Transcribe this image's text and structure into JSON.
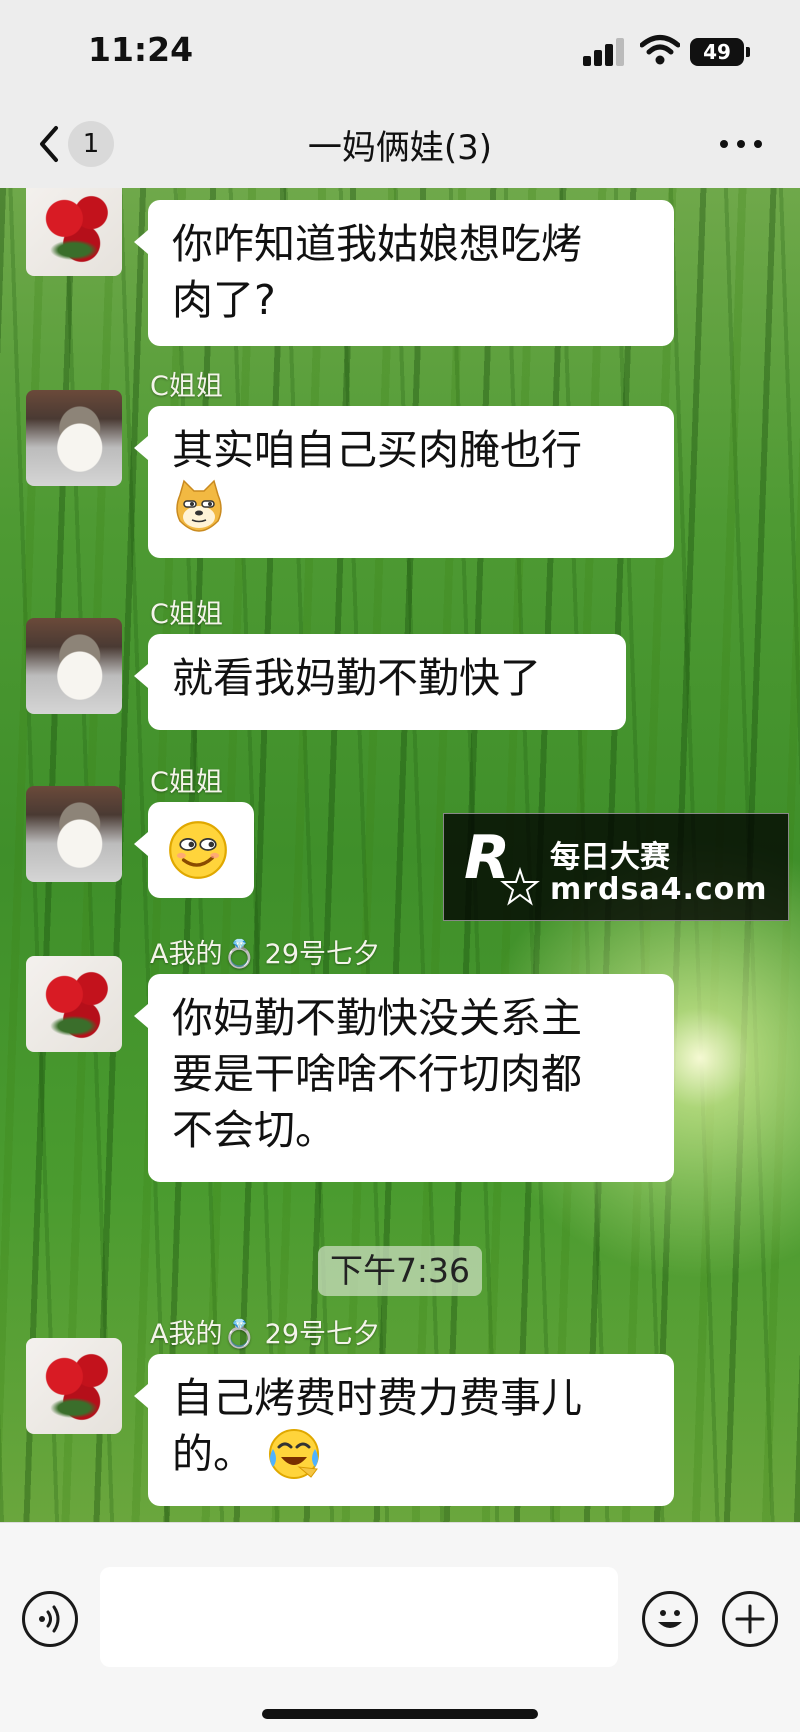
{
  "status_bar": {
    "time": "11:24",
    "battery": "49"
  },
  "nav": {
    "unread_count": "1",
    "title": "一妈俩娃(3)"
  },
  "messages": [
    {
      "text_lines": [
        "你咋知道我姑娘想吃烤",
        "肉了?"
      ],
      "avatar": "rose"
    },
    {
      "sender": "C姐姐",
      "text_lines": [
        "其实咱自己买肉腌也行"
      ],
      "emoji": "doge-emoji",
      "avatar": "cat"
    },
    {
      "sender": "C姐姐",
      "text_lines": [
        "就看我妈勤不勤快了"
      ],
      "avatar": "cat"
    },
    {
      "sender": "C姐姐",
      "emoji": "smirk-emoji",
      "avatar": "cat"
    },
    {
      "sender": "A我的💍 29号七夕",
      "text_lines": [
        "你妈勤不勤快没关系主",
        "要是干啥啥不行切肉都",
        "不会切。"
      ],
      "avatar": "rose"
    },
    {
      "sender": "A我的💍 29号七夕",
      "text_lines": [
        "自己烤费时费力费事儿",
        "的。"
      ],
      "emoji": "laugh-cry-emoji",
      "avatar": "rose"
    }
  ],
  "time_divider": "下午7:36",
  "watermark": {
    "title": "每日大赛",
    "url": "mrdsa4.com"
  },
  "input": {
    "placeholder": ""
  }
}
